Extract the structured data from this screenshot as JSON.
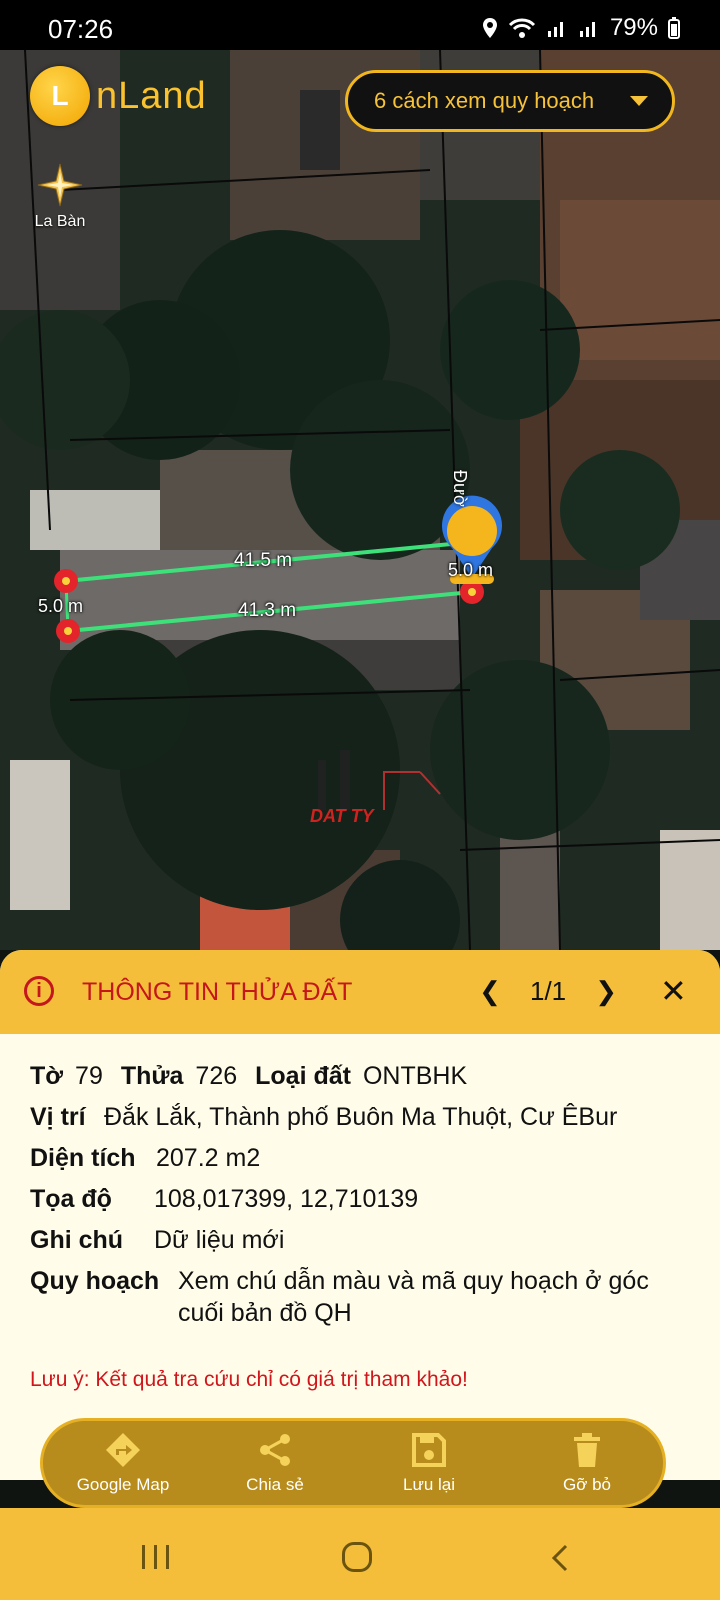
{
  "status": {
    "time": "07:26",
    "battery": "79%"
  },
  "app": {
    "name": "nLand",
    "logo_letter": "L"
  },
  "compass": {
    "label": "La Bàn"
  },
  "planning_dropdown": {
    "label": "6 cách xem quy hoạch"
  },
  "map": {
    "measurements": {
      "top": "41.5 m",
      "bottom": "41.3 m",
      "left": "5.0 m",
      "right": "5.0 m"
    },
    "road_label": "Đườ",
    "watermark": "DAT TY"
  },
  "panel": {
    "title": "THÔNG TIN THỬA ĐẤT",
    "pager": "1/1",
    "to_label": "Tờ",
    "to_value": "79",
    "thua_label": "Thửa",
    "thua_value": "726",
    "loaidat_label": "Loại đất",
    "loaidat_value": "ONTBHK",
    "vitri_label": "Vị trí",
    "vitri_value": "Đắk Lắk, Thành phố Buôn Ma Thuột, Cư ÊBur",
    "dientich_label": "Diện tích",
    "dientich_value": "207.2 m2",
    "toado_label": "Tọa độ",
    "toado_value": "108,017399, 12,710139",
    "ghichu_label": "Ghi chú",
    "ghichu_value": "Dữ liệu mới",
    "quyhoach_label": "Quy hoạch",
    "quyhoach_value": "Xem chú dẫn màu và mã quy hoạch ở góc cuối bản đồ QH",
    "note": "Lưu ý: Kết quả tra cứu chỉ có giá trị tham khảo!"
  },
  "actions": {
    "google_map": "Google Map",
    "share": "Chia sẻ",
    "save": "Lưu lại",
    "remove": "Gỡ bỏ"
  },
  "colors": {
    "accent": "#f4be3a",
    "title_red": "#c4161c",
    "measure_line": "#3ee07a"
  }
}
